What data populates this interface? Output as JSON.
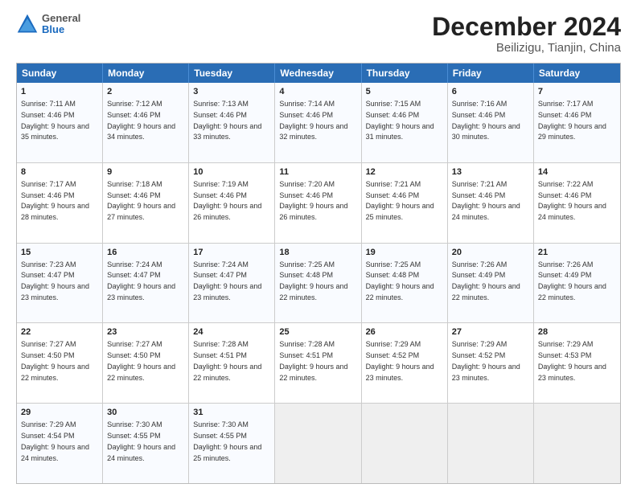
{
  "header": {
    "logo": {
      "general": "General",
      "blue": "Blue"
    },
    "title": "December 2024",
    "subtitle": "Beilizigu, Tianjin, China"
  },
  "calendar": {
    "days": [
      "Sunday",
      "Monday",
      "Tuesday",
      "Wednesday",
      "Thursday",
      "Friday",
      "Saturday"
    ],
    "rows": [
      [
        {
          "day": "1",
          "sunrise": "Sunrise: 7:11 AM",
          "sunset": "Sunset: 4:46 PM",
          "daylight": "Daylight: 9 hours and 35 minutes."
        },
        {
          "day": "2",
          "sunrise": "Sunrise: 7:12 AM",
          "sunset": "Sunset: 4:46 PM",
          "daylight": "Daylight: 9 hours and 34 minutes."
        },
        {
          "day": "3",
          "sunrise": "Sunrise: 7:13 AM",
          "sunset": "Sunset: 4:46 PM",
          "daylight": "Daylight: 9 hours and 33 minutes."
        },
        {
          "day": "4",
          "sunrise": "Sunrise: 7:14 AM",
          "sunset": "Sunset: 4:46 PM",
          "daylight": "Daylight: 9 hours and 32 minutes."
        },
        {
          "day": "5",
          "sunrise": "Sunrise: 7:15 AM",
          "sunset": "Sunset: 4:46 PM",
          "daylight": "Daylight: 9 hours and 31 minutes."
        },
        {
          "day": "6",
          "sunrise": "Sunrise: 7:16 AM",
          "sunset": "Sunset: 4:46 PM",
          "daylight": "Daylight: 9 hours and 30 minutes."
        },
        {
          "day": "7",
          "sunrise": "Sunrise: 7:17 AM",
          "sunset": "Sunset: 4:46 PM",
          "daylight": "Daylight: 9 hours and 29 minutes."
        }
      ],
      [
        {
          "day": "8",
          "sunrise": "Sunrise: 7:17 AM",
          "sunset": "Sunset: 4:46 PM",
          "daylight": "Daylight: 9 hours and 28 minutes."
        },
        {
          "day": "9",
          "sunrise": "Sunrise: 7:18 AM",
          "sunset": "Sunset: 4:46 PM",
          "daylight": "Daylight: 9 hours and 27 minutes."
        },
        {
          "day": "10",
          "sunrise": "Sunrise: 7:19 AM",
          "sunset": "Sunset: 4:46 PM",
          "daylight": "Daylight: 9 hours and 26 minutes."
        },
        {
          "day": "11",
          "sunrise": "Sunrise: 7:20 AM",
          "sunset": "Sunset: 4:46 PM",
          "daylight": "Daylight: 9 hours and 26 minutes."
        },
        {
          "day": "12",
          "sunrise": "Sunrise: 7:21 AM",
          "sunset": "Sunset: 4:46 PM",
          "daylight": "Daylight: 9 hours and 25 minutes."
        },
        {
          "day": "13",
          "sunrise": "Sunrise: 7:21 AM",
          "sunset": "Sunset: 4:46 PM",
          "daylight": "Daylight: 9 hours and 24 minutes."
        },
        {
          "day": "14",
          "sunrise": "Sunrise: 7:22 AM",
          "sunset": "Sunset: 4:46 PM",
          "daylight": "Daylight: 9 hours and 24 minutes."
        }
      ],
      [
        {
          "day": "15",
          "sunrise": "Sunrise: 7:23 AM",
          "sunset": "Sunset: 4:47 PM",
          "daylight": "Daylight: 9 hours and 23 minutes."
        },
        {
          "day": "16",
          "sunrise": "Sunrise: 7:24 AM",
          "sunset": "Sunset: 4:47 PM",
          "daylight": "Daylight: 9 hours and 23 minutes."
        },
        {
          "day": "17",
          "sunrise": "Sunrise: 7:24 AM",
          "sunset": "Sunset: 4:47 PM",
          "daylight": "Daylight: 9 hours and 23 minutes."
        },
        {
          "day": "18",
          "sunrise": "Sunrise: 7:25 AM",
          "sunset": "Sunset: 4:48 PM",
          "daylight": "Daylight: 9 hours and 22 minutes."
        },
        {
          "day": "19",
          "sunrise": "Sunrise: 7:25 AM",
          "sunset": "Sunset: 4:48 PM",
          "daylight": "Daylight: 9 hours and 22 minutes."
        },
        {
          "day": "20",
          "sunrise": "Sunrise: 7:26 AM",
          "sunset": "Sunset: 4:49 PM",
          "daylight": "Daylight: 9 hours and 22 minutes."
        },
        {
          "day": "21",
          "sunrise": "Sunrise: 7:26 AM",
          "sunset": "Sunset: 4:49 PM",
          "daylight": "Daylight: 9 hours and 22 minutes."
        }
      ],
      [
        {
          "day": "22",
          "sunrise": "Sunrise: 7:27 AM",
          "sunset": "Sunset: 4:50 PM",
          "daylight": "Daylight: 9 hours and 22 minutes."
        },
        {
          "day": "23",
          "sunrise": "Sunrise: 7:27 AM",
          "sunset": "Sunset: 4:50 PM",
          "daylight": "Daylight: 9 hours and 22 minutes."
        },
        {
          "day": "24",
          "sunrise": "Sunrise: 7:28 AM",
          "sunset": "Sunset: 4:51 PM",
          "daylight": "Daylight: 9 hours and 22 minutes."
        },
        {
          "day": "25",
          "sunrise": "Sunrise: 7:28 AM",
          "sunset": "Sunset: 4:51 PM",
          "daylight": "Daylight: 9 hours and 22 minutes."
        },
        {
          "day": "26",
          "sunrise": "Sunrise: 7:29 AM",
          "sunset": "Sunset: 4:52 PM",
          "daylight": "Daylight: 9 hours and 23 minutes."
        },
        {
          "day": "27",
          "sunrise": "Sunrise: 7:29 AM",
          "sunset": "Sunset: 4:52 PM",
          "daylight": "Daylight: 9 hours and 23 minutes."
        },
        {
          "day": "28",
          "sunrise": "Sunrise: 7:29 AM",
          "sunset": "Sunset: 4:53 PM",
          "daylight": "Daylight: 9 hours and 23 minutes."
        }
      ],
      [
        {
          "day": "29",
          "sunrise": "Sunrise: 7:29 AM",
          "sunset": "Sunset: 4:54 PM",
          "daylight": "Daylight: 9 hours and 24 minutes."
        },
        {
          "day": "30",
          "sunrise": "Sunrise: 7:30 AM",
          "sunset": "Sunset: 4:55 PM",
          "daylight": "Daylight: 9 hours and 24 minutes."
        },
        {
          "day": "31",
          "sunrise": "Sunrise: 7:30 AM",
          "sunset": "Sunset: 4:55 PM",
          "daylight": "Daylight: 9 hours and 25 minutes."
        },
        null,
        null,
        null,
        null
      ]
    ]
  }
}
